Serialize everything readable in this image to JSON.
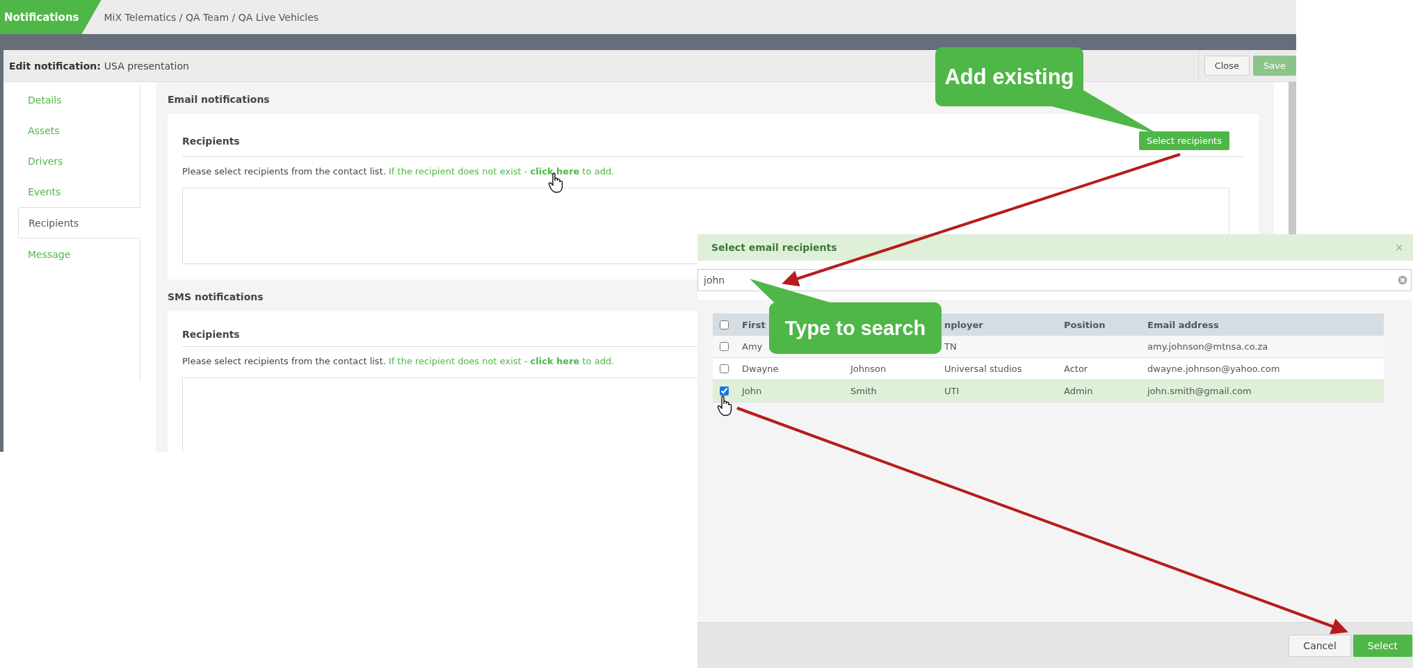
{
  "header": {
    "module": "Notifications",
    "breadcrumb": "MiX Telematics / QA Team / QA Live Vehicles"
  },
  "editor": {
    "title_label": "Edit notification:",
    "title_value": "USA presentation",
    "buttons": [
      {
        "label": "Close",
        "kind": "secondary",
        "disabled": false
      },
      {
        "label": "Save",
        "kind": "primary",
        "disabled": true
      }
    ]
  },
  "sidebar": {
    "items": [
      {
        "label": "Details",
        "selected": false
      },
      {
        "label": "Assets",
        "selected": false
      },
      {
        "label": "Drivers",
        "selected": false
      },
      {
        "label": "Events",
        "selected": false
      },
      {
        "label": "Recipients",
        "selected": true
      },
      {
        "label": "Message",
        "selected": false
      }
    ]
  },
  "sections": [
    {
      "heading": "Email notifications",
      "recipients_label": "Recipients",
      "select_button": "Select recipients",
      "instruction": "Please select recipients from the contact list.",
      "link_text": "If the recipient does not exist - **click here** to add."
    },
    {
      "heading": "SMS notifications",
      "recipients_label": "Recipients",
      "instruction": "Please select recipients from the contact list.",
      "link_text": "If the recipient does not exist - **click here** to add."
    }
  ],
  "dialog": {
    "title": "Select email recipients",
    "close": "×",
    "search": {
      "value": "john"
    },
    "table": {
      "select_all": false,
      "header": {
        "first": "First",
        "employer": "nployer",
        "position": "Position",
        "email": "Email address"
      },
      "rows": [
        {
          "selected": false,
          "first": "Amy",
          "employer": "TN",
          "email": "amy.johnson@mtnsa.co.za"
        },
        {
          "selected": false,
          "first": "Dwayne",
          "last": "Johnson",
          "employer": "Universal studios",
          "position": "Actor",
          "email": "dwayne.johnson@yahoo.com"
        },
        {
          "selected": true,
          "first": "John",
          "last": "Smith",
          "employer": "UTI",
          "position": "Admin",
          "email": "john.smith@gmail.com"
        }
      ]
    },
    "buttons": [
      {
        "label": "Cancel",
        "kind": "secondary"
      },
      {
        "label": "Select",
        "kind": "primary"
      }
    ]
  },
  "callouts": [
    {
      "text": "Add existing",
      "kind": "top"
    },
    {
      "text": "Type to search",
      "kind": "bottom"
    }
  ]
}
